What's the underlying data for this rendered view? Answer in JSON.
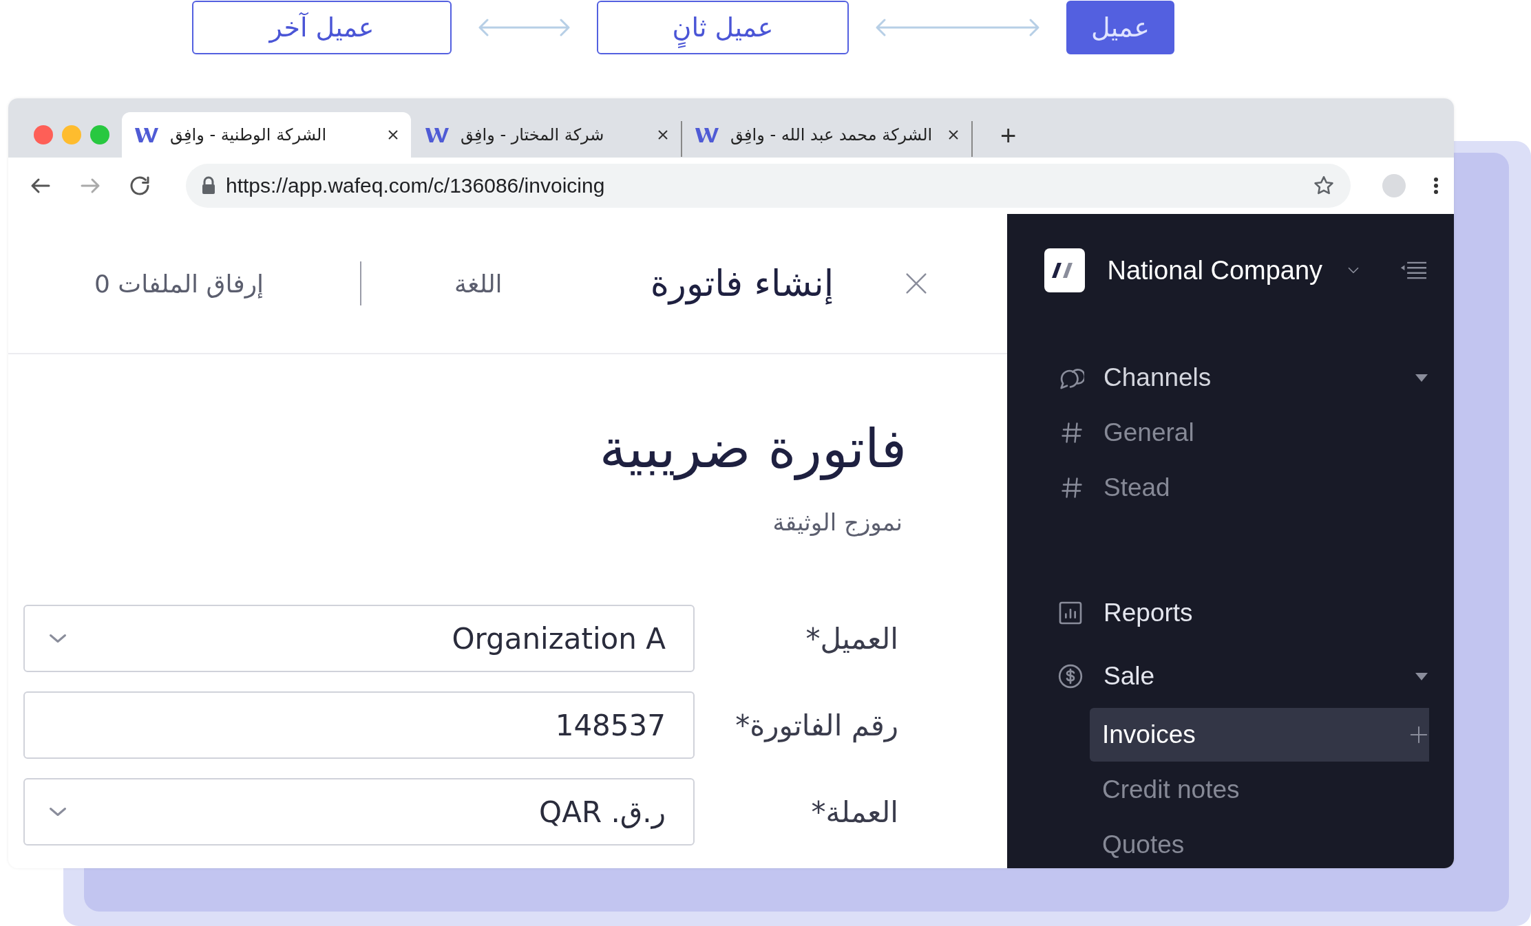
{
  "client_switcher": [
    {
      "label": "عميل",
      "selected": true
    },
    {
      "label": "عميل ثانٍ",
      "selected": false
    },
    {
      "label": "عميل آخر",
      "selected": false
    }
  ],
  "browser": {
    "tabs": [
      {
        "title": "الشركة محمد عبد الله - وافِق",
        "selected": false
      },
      {
        "title": "شركة المختار - وافِق",
        "selected": false
      },
      {
        "title": "الشركة الوطنية - وافِق",
        "selected": true
      }
    ],
    "new_tab": "+",
    "url": "https://app.wafeq.com/c/136086/invoicing"
  },
  "form_header": {
    "title": "إنشاء فاتورة",
    "language": "اللغة",
    "attachments": "إرفاق الملفات 0"
  },
  "document": {
    "title": "فاتورة ضريبية",
    "subtitle": "نموزج الوثيقة",
    "fields": [
      {
        "label": "العميل*",
        "value": "Organization A",
        "kind": "select"
      },
      {
        "label": "رقم الفاتورة*",
        "value": "148537",
        "kind": "text"
      },
      {
        "label": "العملة*",
        "value": "ر.ق. QAR",
        "kind": "select"
      }
    ]
  },
  "sidebar": {
    "company": "National Company",
    "groups": [
      [
        {
          "label": "Channels",
          "expanded": true,
          "children": [
            {
              "label": "General",
              "selected": false
            },
            {
              "label": "Stead",
              "selected": false
            }
          ]
        }
      ],
      [
        {
          "label": "Reports"
        },
        {
          "label": "Sale",
          "expanded": true,
          "children": [
            {
              "label": "Invoices",
              "selected": true
            },
            {
              "label": "Credit notes",
              "selected": false
            },
            {
              "label": "Quotes",
              "selected": false
            }
          ]
        }
      ]
    ]
  }
}
